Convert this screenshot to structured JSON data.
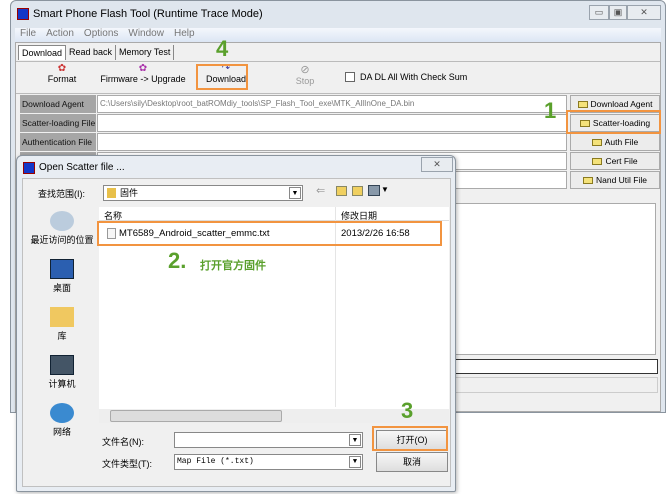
{
  "window": {
    "title": "Smart Phone Flash Tool (Runtime Trace Mode)",
    "controls": [
      "▭",
      "▣",
      "✕"
    ]
  },
  "menu": [
    "File",
    "Action",
    "Options",
    "Window",
    "Help"
  ],
  "tabs": [
    "Download",
    "Read back",
    "Memory Test"
  ],
  "toolbar": {
    "format": "Format",
    "firmware": "Firmware -> Upgrade",
    "download": "Download",
    "stop": "Stop",
    "checksum": "DA DL All With Check Sum"
  },
  "rows": [
    {
      "label": "Download Agent",
      "value": "C:\\Users\\sily\\Desktop\\root_batROMdiy_tools\\SP_Flash_Tool_exe\\MTK_AllInOne_DA.bin",
      "button": "Download Agent"
    },
    {
      "label": "Scatter-loading File",
      "value": "",
      "button": "Scatter-loading"
    },
    {
      "label": "Authentication File",
      "value": "",
      "button": "Auth File"
    },
    {
      "label": "",
      "value": "",
      "button": "Cert File"
    },
    {
      "label": "",
      "value": "",
      "button": "Nand Util File"
    }
  ],
  "dialog": {
    "title": "Open Scatter file ...",
    "look_in_label": "查找范围(I):",
    "look_in_value": "固件",
    "places": [
      "最近访问的位置",
      "桌面",
      "库",
      "计算机",
      "网络"
    ],
    "columns": [
      "名称",
      "修改日期"
    ],
    "files": [
      {
        "name": "MT6589_Android_scatter_emmc.txt",
        "date": "2013/2/26 16:58"
      }
    ],
    "filename_label": "文件名(N):",
    "filename_value": "",
    "filetype_label": "文件类型(T):",
    "filetype_value": "Map File (*.txt)",
    "open": "打开(O)",
    "cancel": "取消"
  },
  "annotations": {
    "step1": "1",
    "step2": "2.",
    "step2_text": "打开官方固件",
    "step3": "3",
    "step4": "4"
  },
  "colors": {
    "highlight": "#f29440",
    "step": "#5aa02c"
  }
}
